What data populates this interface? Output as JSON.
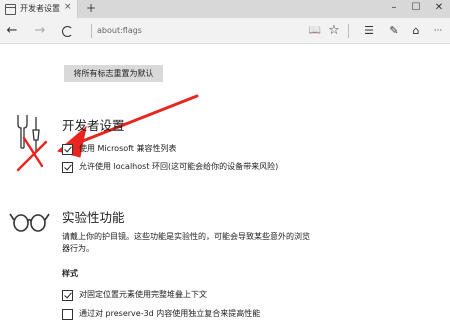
{
  "tab": {
    "title": "开发者设置",
    "close": "×"
  },
  "new_tab": "+",
  "window_controls": {
    "minimize": "–",
    "maximize": "☐",
    "close": "✕"
  },
  "nav": {
    "back": "←",
    "forward": "→",
    "address": "about:flags",
    "reading_view": "📖",
    "favorite": "☆",
    "hub": "☰",
    "note": "✎",
    "share": "⌂",
    "more": "···"
  },
  "reset_button": "将所有标志重置为默认",
  "developer": {
    "title": "开发者设置",
    "options": [
      {
        "label": "使用 Microsoft 兼容性列表",
        "checked": true
      },
      {
        "label": "允许使用 localhost 环回(这可能会给你的设备带来风险)",
        "checked": true
      }
    ]
  },
  "experimental": {
    "title": "实验性功能",
    "description": "请戴上你的护目镜。这些功能是实验性的，可能会导致某些意外的浏览器行为。"
  },
  "styles": {
    "heading": "样式",
    "options": [
      {
        "label": "对固定位置元素使用完整堆叠上下文",
        "checked": true
      },
      {
        "label": "通过对 preserve-3d 内容使用独立复合来提高性能",
        "checked": false
      }
    ]
  },
  "annotation": {
    "arrow_color": "#e8251f"
  }
}
